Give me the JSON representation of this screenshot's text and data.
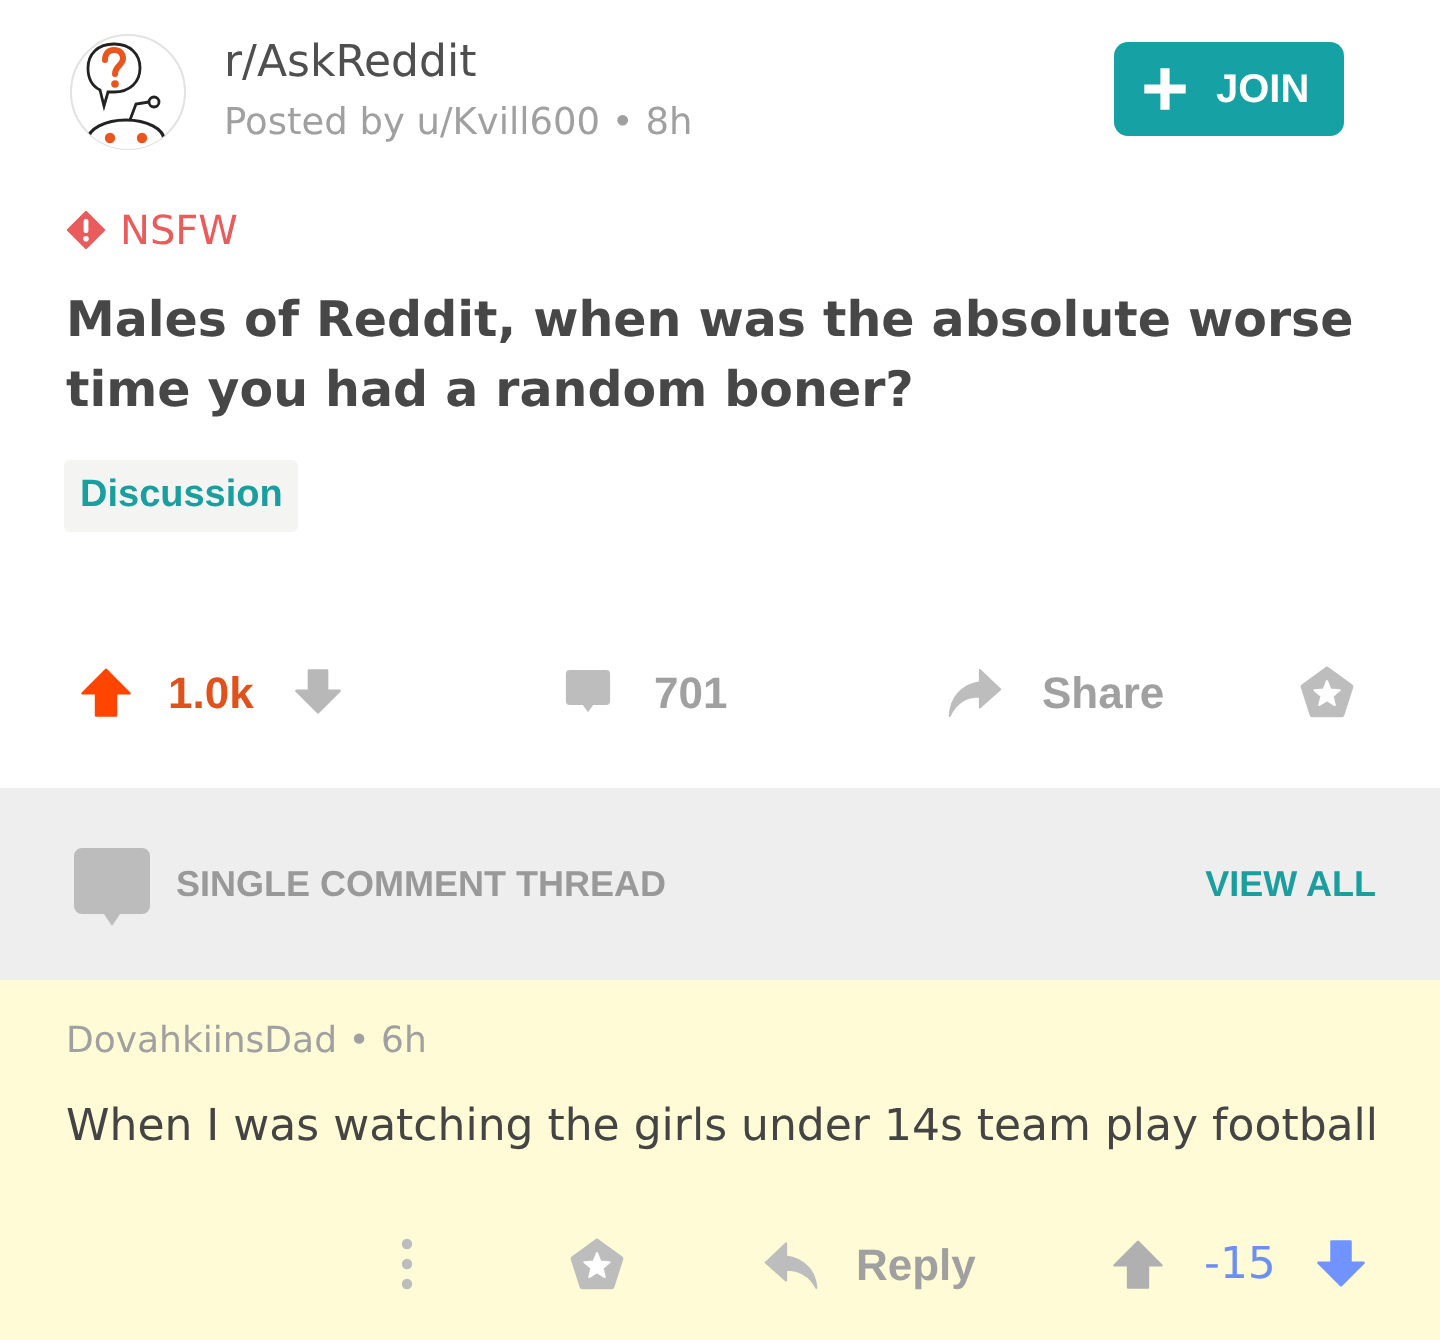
{
  "post": {
    "subreddit": "r/AskReddit",
    "byline": "Posted by u/Kvill600 • 8h",
    "join_label": "JOIN",
    "nsfw_label": "NSFW",
    "title": "Males of Reddit, when was the absolute worse time you had a random boner?",
    "flair": "Discussion",
    "upvoted": true,
    "downvoted": false,
    "score": "1.0k",
    "comment_count": "701",
    "share_label": "Share"
  },
  "thread_banner": {
    "label": "SINGLE COMMENT THREAD",
    "view_all": "VIEW ALL"
  },
  "comment": {
    "meta": "DovahkiinsDad • 6h",
    "body": "When I was watching the girls under 14s team play football",
    "highlighted": true,
    "reply_label": "Reply",
    "upvoted": false,
    "downvoted": true,
    "score": "-15"
  }
}
